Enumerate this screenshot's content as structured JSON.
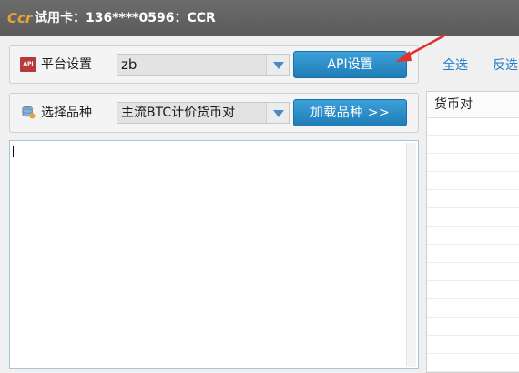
{
  "titlebar": {
    "logo_text": "Ccr",
    "title": "试用卡：136****0596：CCR"
  },
  "platform_row": {
    "icon": "api-icon",
    "icon_text": "API",
    "label": "平台设置",
    "select_value": "zb",
    "button_label": "API设置"
  },
  "symbol_row": {
    "icon": "database-icon",
    "label": "选择品种",
    "select_value": "主流BTC计价货币对",
    "button_label": "加载品种 >>"
  },
  "list_actions": {
    "select_all": "全选",
    "invert": "反选"
  },
  "symbol_list": {
    "header": "货币对",
    "rows": [
      "",
      "",
      "",
      "",
      "",
      "",
      "",
      "",
      "",
      "",
      "",
      "",
      "",
      ""
    ]
  },
  "colors": {
    "titlebar": "#5f5f5f",
    "button": "#2a8cc8",
    "link": "#1f78c8",
    "annotation_arrow": "#e03030"
  }
}
